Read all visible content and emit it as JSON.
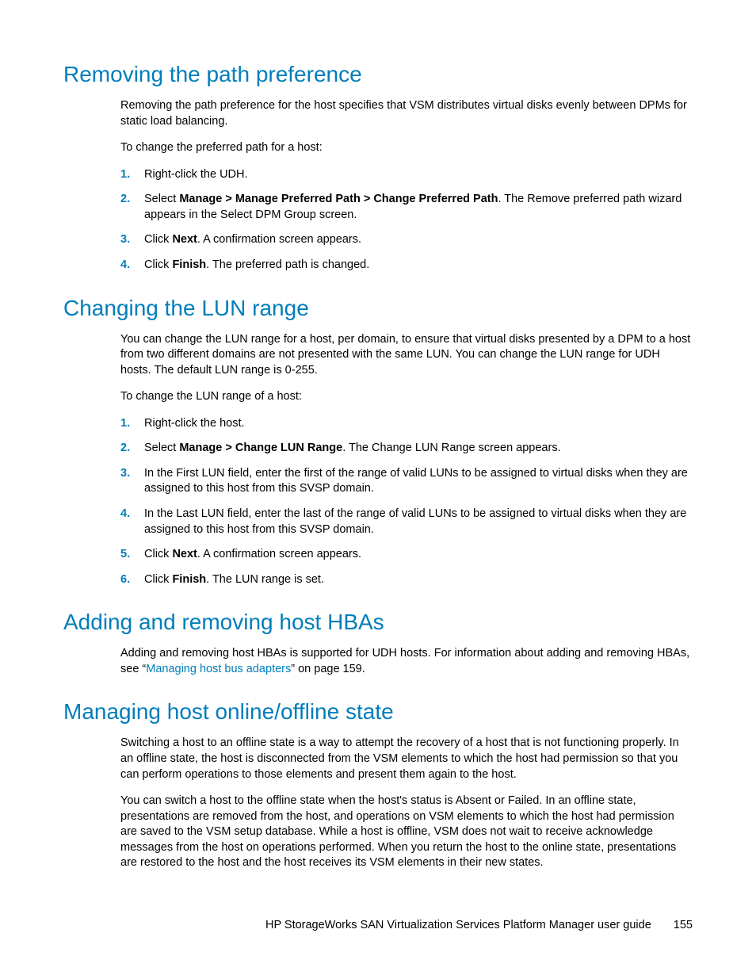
{
  "sections": [
    {
      "heading": "Removing the path preference",
      "paras": [
        "Removing the path preference for the host specifies that VSM distributes virtual disks evenly between DPMs for static load balancing.",
        "To change the preferred path for a host:"
      ],
      "steps": [
        {
          "n": "1.",
          "runs": [
            {
              "t": "Right-click the UDH."
            }
          ]
        },
        {
          "n": "2.",
          "runs": [
            {
              "t": "Select "
            },
            {
              "t": "Manage > Manage Preferred Path > Change Preferred Path",
              "b": true
            },
            {
              "t": ". The Remove preferred path wizard appears in the Select DPM Group screen."
            }
          ]
        },
        {
          "n": "3.",
          "runs": [
            {
              "t": "Click "
            },
            {
              "t": "Next",
              "b": true
            },
            {
              "t": ". A confirmation screen appears."
            }
          ]
        },
        {
          "n": "4.",
          "runs": [
            {
              "t": "Click "
            },
            {
              "t": "Finish",
              "b": true
            },
            {
              "t": ". The preferred path is changed."
            }
          ]
        }
      ]
    },
    {
      "heading": "Changing the LUN range",
      "paras": [
        "You can change the LUN range for a host, per domain, to ensure that virtual disks presented by a DPM to a host from two different domains are not presented with the same LUN. You can change the LUN range for UDH hosts. The default LUN range is 0-255.",
        "To change the LUN range of a host:"
      ],
      "steps": [
        {
          "n": "1.",
          "runs": [
            {
              "t": "Right-click the host."
            }
          ]
        },
        {
          "n": "2.",
          "runs": [
            {
              "t": "Select "
            },
            {
              "t": "Manage > Change LUN Range",
              "b": true
            },
            {
              "t": ". The Change LUN Range screen appears."
            }
          ]
        },
        {
          "n": "3.",
          "runs": [
            {
              "t": "In the First LUN field, enter the first of the range of valid LUNs to be assigned to virtual disks when they are assigned to this host from this SVSP domain."
            }
          ]
        },
        {
          "n": "4.",
          "runs": [
            {
              "t": "In the Last LUN field, enter the last of the range of valid LUNs to be assigned to virtual disks when they are assigned to this host from this SVSP domain."
            }
          ]
        },
        {
          "n": "5.",
          "runs": [
            {
              "t": "Click "
            },
            {
              "t": "Next",
              "b": true
            },
            {
              "t": ". A confirmation screen appears."
            }
          ]
        },
        {
          "n": "6.",
          "runs": [
            {
              "t": "Click "
            },
            {
              "t": "Finish",
              "b": true
            },
            {
              "t": ". The LUN range is set."
            }
          ]
        }
      ]
    },
    {
      "heading": "Adding and removing host HBAs",
      "rich_paras": [
        [
          {
            "t": "Adding and removing host HBAs is supported for UDH hosts. For information about adding and removing HBAs, see “"
          },
          {
            "t": "Managing host bus adapters",
            "link": true
          },
          {
            "t": "” on page 159."
          }
        ]
      ]
    },
    {
      "heading": "Managing host online/offline state",
      "paras": [
        "Switching a host to an offline state is a way to attempt the recovery of a host that is not functioning properly. In an offline state, the host is disconnected from the VSM elements to which the host had permission so that you can perform operations to those elements and present them again to the host.",
        "You can switch a host to the offline state when the host's status is Absent or Failed. In an offline state, presentations are removed from the host, and operations on VSM elements to which the host had permission are saved to the VSM setup database. While a host is offline, VSM does not wait to receive acknowledge messages from the host on operations performed. When you return the host to the online state, presentations are restored to the host and the host receives its VSM elements in their new states."
      ]
    }
  ],
  "footer": {
    "title": "HP StorageWorks SAN Virtualization Services Platform Manager user guide",
    "page": "155"
  }
}
